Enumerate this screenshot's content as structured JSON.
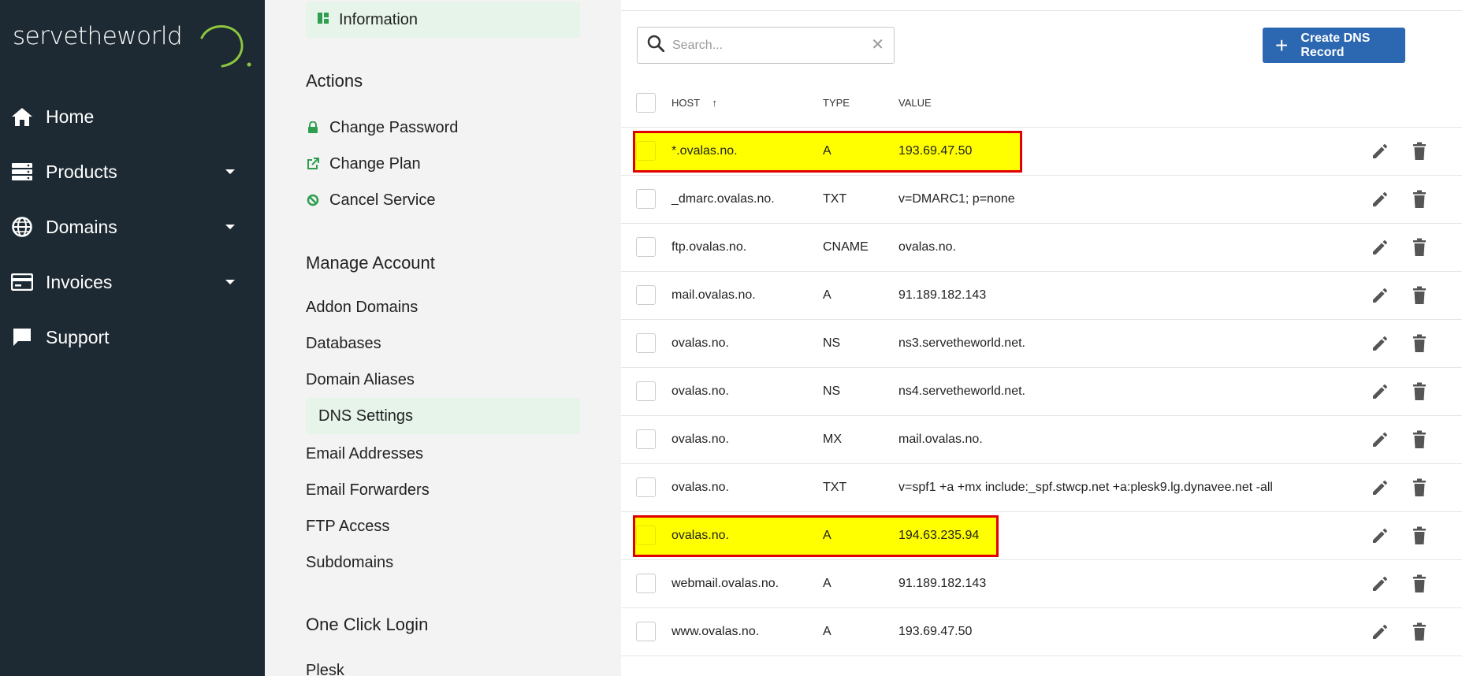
{
  "brand": {
    "logo_text": "servetheworld",
    "accent": "#8dc63f"
  },
  "nav": [
    {
      "label": "Home",
      "icon": "home-icon",
      "has_caret": false
    },
    {
      "label": "Products",
      "icon": "server-icon",
      "has_caret": true
    },
    {
      "label": "Domains",
      "icon": "globe-icon",
      "has_caret": true
    },
    {
      "label": "Invoices",
      "icon": "credit-card-icon",
      "has_caret": true
    },
    {
      "label": "Support",
      "icon": "chat-icon",
      "has_caret": false
    }
  ],
  "side": {
    "information": "Information",
    "actions_title": "Actions",
    "actions": [
      "Change Password",
      "Change Plan",
      "Cancel Service"
    ],
    "manage_title": "Manage Account",
    "manage": [
      "Addon Domains",
      "Databases",
      "Domain Aliases",
      "DNS Settings",
      "Email Addresses",
      "Email Forwarders",
      "FTP Access",
      "Subdomains"
    ],
    "oneclick_title": "One Click Login",
    "oneclick_first": "Plesk"
  },
  "toolbar": {
    "search_placeholder": "Search...",
    "create_label": "Create DNS Record"
  },
  "table": {
    "headers": {
      "host": "HOST",
      "type": "TYPE",
      "value": "VALUE",
      "sort_arrow": "↑"
    },
    "rows": [
      {
        "host": "*.ovalas.no.",
        "type": "A",
        "value": "193.69.47.50",
        "highlight": true
      },
      {
        "host": "_dmarc.ovalas.no.",
        "type": "TXT",
        "value": "v=DMARC1; p=none",
        "highlight": false
      },
      {
        "host": "ftp.ovalas.no.",
        "type": "CNAME",
        "value": "ovalas.no.",
        "highlight": false
      },
      {
        "host": "mail.ovalas.no.",
        "type": "A",
        "value": "91.189.182.143",
        "highlight": false
      },
      {
        "host": "ovalas.no.",
        "type": "NS",
        "value": "ns3.servetheworld.net.",
        "highlight": false
      },
      {
        "host": "ovalas.no.",
        "type": "NS",
        "value": "ns4.servetheworld.net.",
        "highlight": false
      },
      {
        "host": "ovalas.no.",
        "type": "MX",
        "value": "mail.ovalas.no.",
        "highlight": false
      },
      {
        "host": "ovalas.no.",
        "type": "TXT",
        "value": "v=spf1 +a +mx include:_spf.stwcp.net +a:plesk9.lg.dynavee.net -all",
        "highlight": false
      },
      {
        "host": "ovalas.no.",
        "type": "A",
        "value": "194.63.235.94",
        "highlight": true
      },
      {
        "host": "webmail.ovalas.no.",
        "type": "A",
        "value": "91.189.182.143",
        "highlight": false
      },
      {
        "host": "www.ovalas.no.",
        "type": "A",
        "value": "193.69.47.50",
        "highlight": false
      }
    ]
  }
}
